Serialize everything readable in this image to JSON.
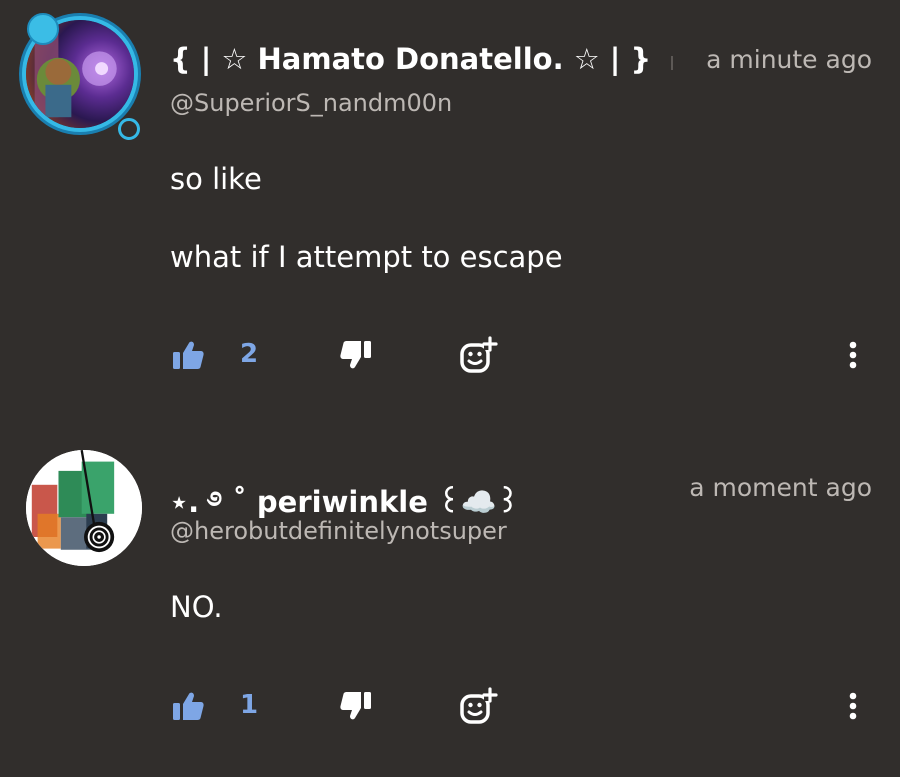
{
  "colors": {
    "background": "#312e2c",
    "primary_text": "#ffffff",
    "secondary_text": "#bdb8b4",
    "like_accent": "#7ea6e5",
    "icon_white": "#ffffff",
    "avatar_ring": "#35b9e6"
  },
  "comments": [
    {
      "display_name": "{ | ☆ Hamato Donatello. ☆ | }",
      "timestamp": "a minute ago",
      "username": "@SuperiorS_nandm00n",
      "body_lines": [
        "so like",
        "what if I attempt to escape"
      ],
      "likes": "2",
      "icons": {
        "like": "thumbs-up-icon",
        "dislike": "thumbs-down-icon",
        "react": "add-reaction-icon",
        "more": "more-vertical-icon"
      }
    },
    {
      "display_name": "⋆. ࿔ ˚ periwinkle ꒰☁️꒱",
      "timestamp": "a moment ago",
      "username": "@herobutdefinitelynotsuper",
      "body_lines": [
        "NO."
      ],
      "likes": "1",
      "icons": {
        "like": "thumbs-up-icon",
        "dislike": "thumbs-down-icon",
        "react": "add-reaction-icon",
        "more": "more-vertical-icon"
      }
    }
  ]
}
